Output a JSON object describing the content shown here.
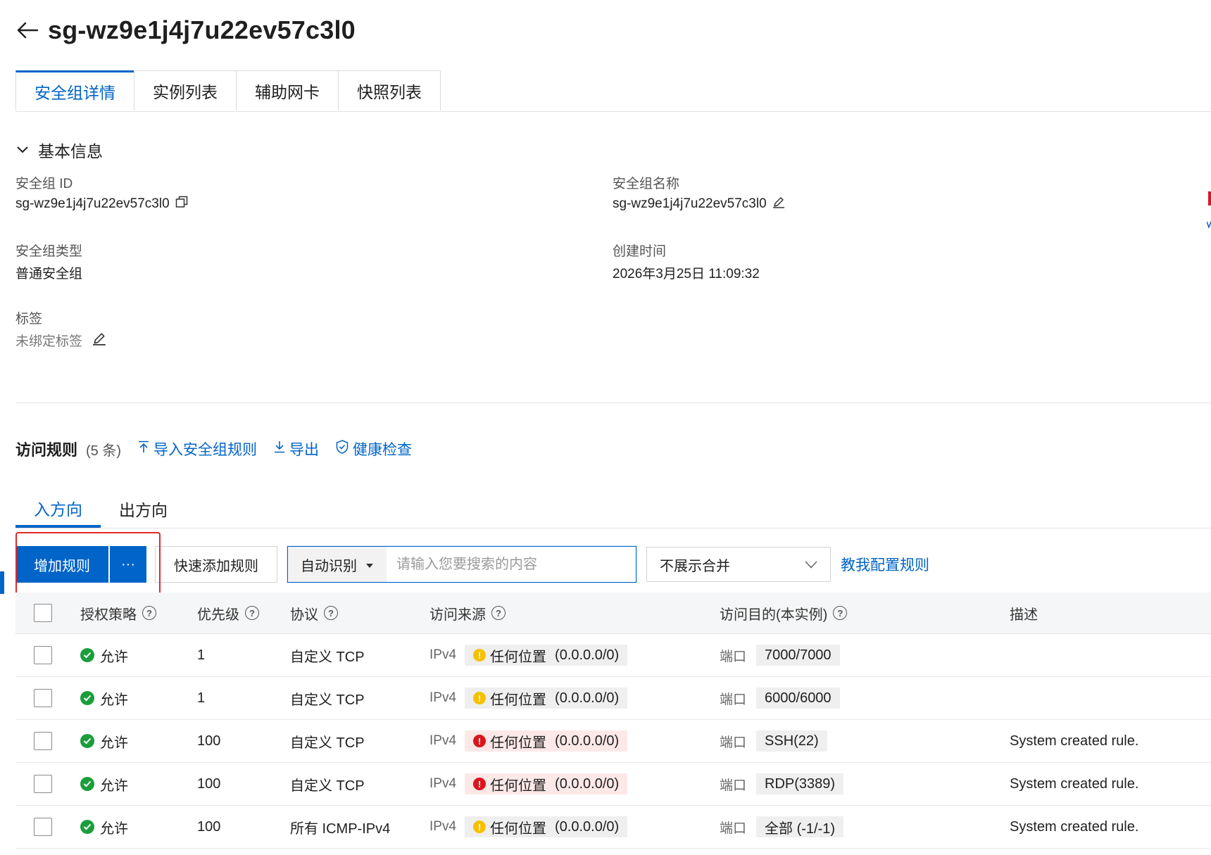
{
  "header": {
    "title": "sg-wz9e1j4j7u22ev57c3l0"
  },
  "tabs": [
    {
      "label": "安全组详情"
    },
    {
      "label": "实例列表"
    },
    {
      "label": "辅助网卡"
    },
    {
      "label": "快照列表"
    }
  ],
  "basic_info": {
    "section_title": "基本信息",
    "id_label": "安全组 ID",
    "id_value": "sg-wz9e1j4j7u22ev57c3l0",
    "name_label": "安全组名称",
    "name_value": "sg-wz9e1j4j7u22ev57c3l0",
    "type_label": "安全组类型",
    "type_value": "普通安全组",
    "created_label": "创建时间",
    "created_value": "2026年3月25日 11:09:32",
    "tag_label": "标签",
    "tag_value": "未绑定标签"
  },
  "rules": {
    "title": "访问规则",
    "count": "(5 条)",
    "import_label": "导入安全组规则",
    "export_label": "导出",
    "health_label": "健康检查",
    "direction_tabs": [
      {
        "label": "入方向"
      },
      {
        "label": "出方向"
      }
    ],
    "toolbar": {
      "add_label": "增加规则",
      "more_label": "···",
      "quick_add_label": "快速添加规则",
      "search_mode": "自动识别",
      "search_placeholder": "请输入您要搜索的内容",
      "merge_select": "不展示合并",
      "help_link": "教我配置规则"
    },
    "columns": {
      "policy": "授权策略",
      "priority": "优先级",
      "protocol": "协议",
      "source": "访问来源",
      "dest": "访问目的(本实例)",
      "desc": "描述"
    },
    "rows": [
      {
        "policy": "允许",
        "priority": "1",
        "protocol": "自定义 TCP",
        "ipv": "IPv4",
        "source": "任何位置",
        "cidr": "(0.0.0.0/0)",
        "risk": "warn",
        "port_label": "端口",
        "port": "7000/7000",
        "desc": ""
      },
      {
        "policy": "允许",
        "priority": "1",
        "protocol": "自定义 TCP",
        "ipv": "IPv4",
        "source": "任何位置",
        "cidr": "(0.0.0.0/0)",
        "risk": "warn",
        "port_label": "端口",
        "port": "6000/6000",
        "desc": ""
      },
      {
        "policy": "允许",
        "priority": "100",
        "protocol": "自定义 TCP",
        "ipv": "IPv4",
        "source": "任何位置",
        "cidr": "(0.0.0.0/0)",
        "risk": "danger",
        "port_label": "端口",
        "port": "SSH(22)",
        "desc": "System created rule."
      },
      {
        "policy": "允许",
        "priority": "100",
        "protocol": "自定义 TCP",
        "ipv": "IPv4",
        "source": "任何位置",
        "cidr": "(0.0.0.0/0)",
        "risk": "danger",
        "port_label": "端口",
        "port": "RDP(3389)",
        "desc": "System created rule."
      },
      {
        "policy": "允许",
        "priority": "100",
        "protocol": "所有 ICMP-IPv4",
        "ipv": "IPv4",
        "source": "任何位置",
        "cidr": "(0.0.0.0/0)",
        "risk": "warn",
        "port_label": "端口",
        "port": "全部 (-1/-1)",
        "desc": "System created rule."
      }
    ]
  },
  "colors": {
    "accent": "#0064c8",
    "success": "#1a9e3b",
    "warning": "#f6c000",
    "danger": "#d9161e",
    "highlight": "#e02828"
  },
  "icons": {
    "back": "arrow-left-icon",
    "copy": "copy-icon",
    "edit": "edit-icon",
    "collapse": "chevron-down-icon",
    "import": "arrow-up-icon",
    "export": "download-icon",
    "health": "shield-check-icon",
    "help": "help-circle-icon",
    "allow": "check-circle-icon",
    "warn": "warning-circle-icon",
    "danger": "error-circle-icon"
  }
}
